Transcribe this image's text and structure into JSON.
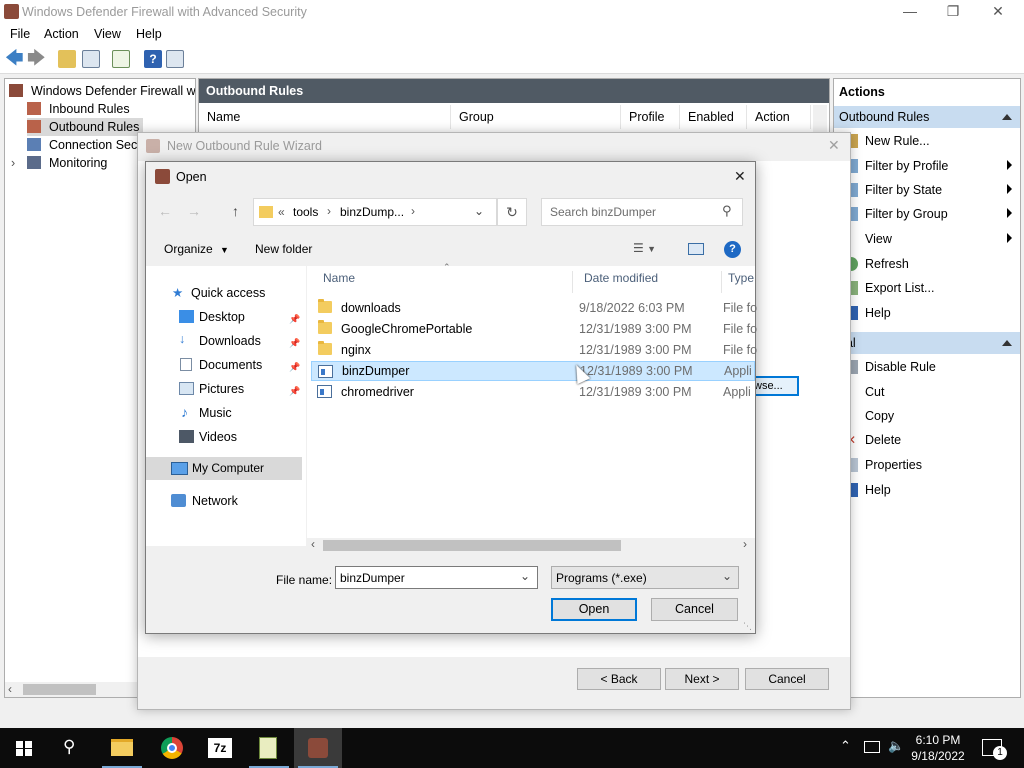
{
  "window": {
    "title": "Windows Defender Firewall with Advanced Security",
    "menu": [
      "File",
      "Action",
      "View",
      "Help"
    ]
  },
  "tree": {
    "root": "Windows Defender Firewall witl",
    "items": [
      "Inbound Rules",
      "Outbound Rules",
      "Connection Secu",
      "Monitoring"
    ]
  },
  "center": {
    "header": "Outbound Rules",
    "columns": [
      "Name",
      "Group",
      "Profile",
      "Enabled",
      "Action"
    ]
  },
  "actions": {
    "header": "Actions",
    "section1": "Outbound Rules",
    "items1": [
      "New Rule...",
      "Filter by Profile",
      "Filter by State",
      "Filter by Group",
      "View",
      "Refresh",
      "Export List...",
      "Help"
    ],
    "section2": "nal",
    "items2": [
      "Disable Rule",
      "Cut",
      "Copy",
      "Delete",
      "Properties",
      "Help"
    ]
  },
  "wizard": {
    "title": "New Outbound Rule Wizard",
    "browse_fragment": "wse...",
    "back": "< Back",
    "next": "Next >",
    "cancel": "Cancel"
  },
  "open_dialog": {
    "title": "Open",
    "breadcrumb": [
      "«",
      "tools",
      "›",
      "binzDump...",
      "›"
    ],
    "search_placeholder": "Search binzDumper",
    "organize": "Organize",
    "new_folder": "New folder",
    "nav": {
      "quick_access": "Quick access",
      "items": [
        "Desktop",
        "Downloads",
        "Documents",
        "Pictures",
        "Music",
        "Videos"
      ],
      "my_computer": "My Computer",
      "network": "Network"
    },
    "columns": [
      "Name",
      "Date modified",
      "Type"
    ],
    "files": [
      {
        "name": "downloads",
        "date": "9/18/2022 6:03 PM",
        "type": "File fo",
        "kind": "folder"
      },
      {
        "name": "GoogleChromePortable",
        "date": "12/31/1989 3:00 PM",
        "type": "File fo",
        "kind": "folder"
      },
      {
        "name": "nginx",
        "date": "12/31/1989 3:00 PM",
        "type": "File fo",
        "kind": "folder"
      },
      {
        "name": "binzDumper",
        "date": "12/31/1989 3:00 PM",
        "type": "Appli",
        "kind": "exe",
        "selected": true
      },
      {
        "name": "chromedriver",
        "date": "12/31/1989 3:00 PM",
        "type": "Appli",
        "kind": "exe"
      }
    ],
    "file_name_label": "File name:",
    "file_name_value": "binzDumper",
    "file_type": "Programs (*.exe)",
    "open_button": "Open",
    "cancel_button": "Cancel"
  },
  "taskbar": {
    "time": "6:10 PM",
    "date": "9/18/2022",
    "notification_count": "1"
  },
  "colors": {
    "header_dark": "#505a64",
    "section_blue": "#c8dcf0",
    "selection": "#cce8ff",
    "accent": "#0078d7"
  }
}
